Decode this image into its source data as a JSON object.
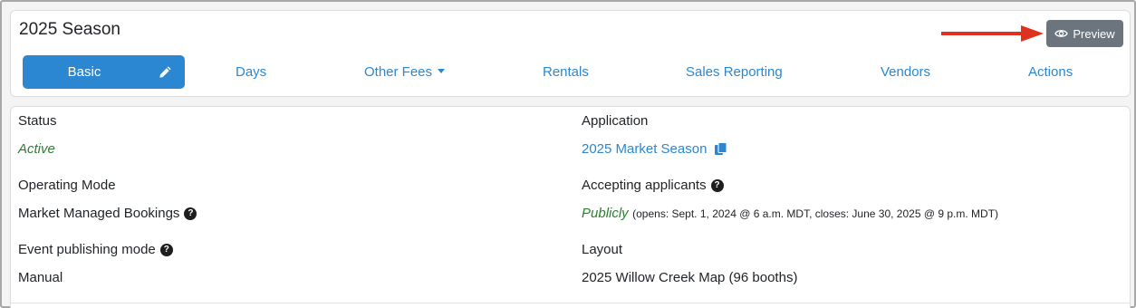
{
  "header": {
    "title": "2025 Season",
    "preview_label": "Preview"
  },
  "tabs": [
    {
      "label": "Basic",
      "active": true
    },
    {
      "label": "Days"
    },
    {
      "label": "Other Fees",
      "dropdown": true
    },
    {
      "label": "Rentals"
    },
    {
      "label": "Sales Reporting"
    },
    {
      "label": "Vendors"
    },
    {
      "label": "Actions"
    }
  ],
  "details": {
    "status_label": "Status",
    "status_value": "Active",
    "application_label": "Application",
    "application_value": "2025 Market Season",
    "operating_mode_label": "Operating Mode",
    "accepting_label": "Accepting applicants",
    "bookings_label": "Market Managed Bookings",
    "accepting_value": "Publicly",
    "accepting_note": "(opens: Sept. 1, 2024 @ 6 a.m. MDT, closes: June 30, 2025 @ 9 p.m. MDT)",
    "publishing_label": "Event publishing mode",
    "publishing_value": "Manual",
    "layout_label": "Layout",
    "layout_value": "2025 Willow Creek Map (96 booths)"
  },
  "icons": {
    "preview": "eye-icon",
    "edit": "pencil-icon",
    "copy": "copy-icon",
    "help": "question-circle-icon",
    "annotation": "red-arrow-icon"
  },
  "colors": {
    "primary": "#2b87d1",
    "secondary": "#6c757d",
    "success_text": "#2e7d32",
    "annotation_arrow": "#e0301e"
  }
}
